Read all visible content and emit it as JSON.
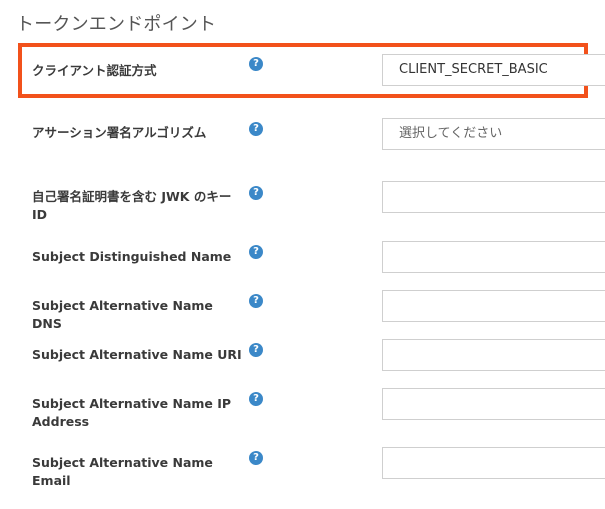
{
  "section": {
    "title": "トークンエンドポイント"
  },
  "fields": [
    {
      "label": "クライアント認証方式",
      "value": "CLIENT_SECRET_BASIC",
      "placeholder": ""
    },
    {
      "label": "アサーション署名アルゴリズム",
      "value": "",
      "placeholder": "選択してください"
    },
    {
      "label": "自己署名証明書を含む JWK のキー ID",
      "value": "",
      "placeholder": ""
    },
    {
      "label": "Subject Distinguished Name",
      "value": "",
      "placeholder": ""
    },
    {
      "label": "Subject Alternative Name DNS",
      "value": "",
      "placeholder": ""
    },
    {
      "label": "Subject Alternative Name URI",
      "value": "",
      "placeholder": ""
    },
    {
      "label": "Subject Alternative Name IP Address",
      "value": "",
      "placeholder": ""
    },
    {
      "label": "Subject Alternative Name Email",
      "value": "",
      "placeholder": ""
    }
  ],
  "help_icon_glyph": "?",
  "colors": {
    "highlight": "#f2511b",
    "help_icon": "#3b88c8"
  }
}
